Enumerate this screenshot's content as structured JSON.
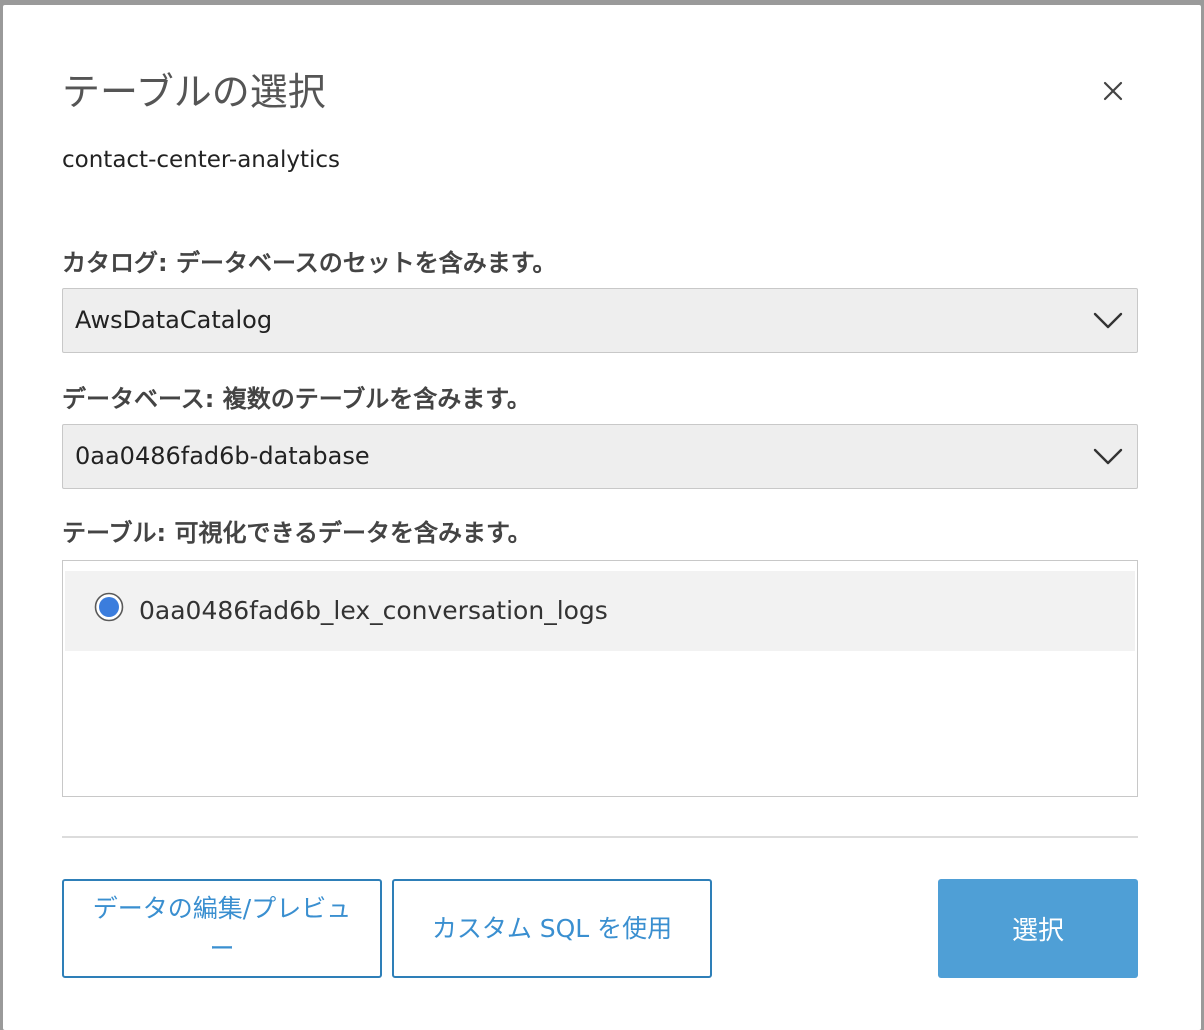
{
  "dialog": {
    "title": "テーブルの選択",
    "subtitle": "contact-center-analytics"
  },
  "catalog": {
    "label": "カタログ: データベースのセットを含みます。",
    "value": "AwsDataCatalog"
  },
  "database": {
    "label": "データベース: 複数のテーブルを含みます。",
    "value": "0aa0486fad6b-database"
  },
  "tables": {
    "label": "テーブル: 可視化できるデータを含みます。",
    "items": [
      {
        "name": "0aa0486fad6b_lex_conversation_logs",
        "selected": true
      }
    ]
  },
  "buttons": {
    "edit_preview": "データの編集/プレビュー",
    "custom_sql": "カスタム SQL を使用",
    "select": "選択"
  },
  "colors": {
    "accent": "#2e7fb8",
    "primary_button": "#4f9fd6",
    "radio_selected": "#3b7ddd"
  },
  "icons": {
    "close": "close-icon",
    "dropdown": "chevron-down-icon"
  }
}
